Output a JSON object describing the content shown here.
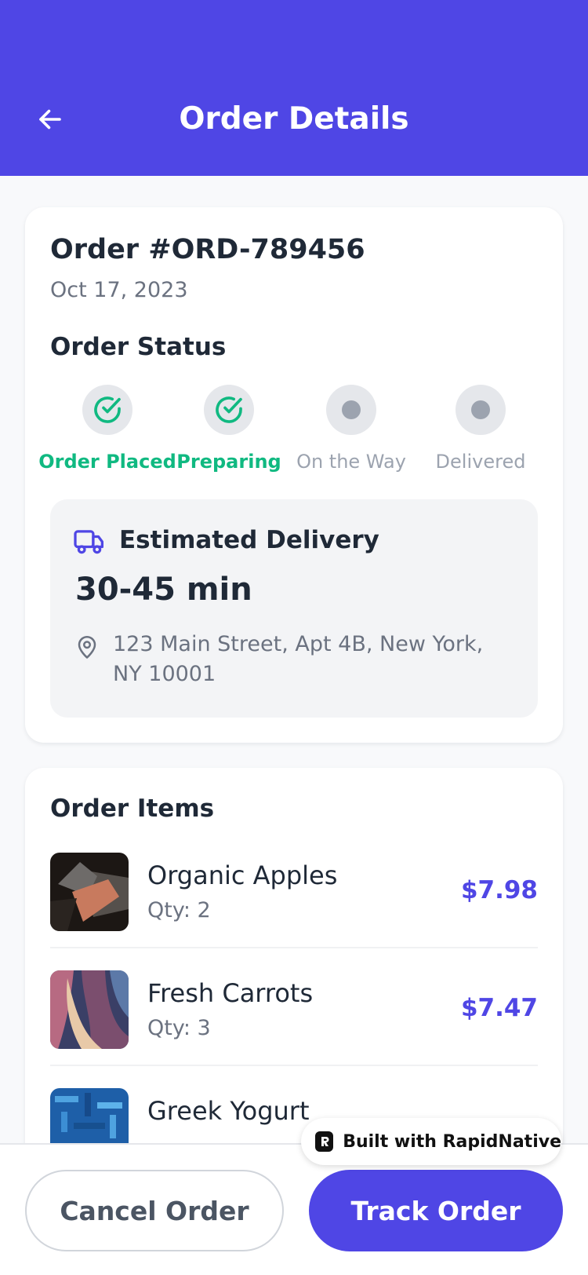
{
  "header": {
    "title": "Order Details",
    "background": "#4F46E5",
    "back_icon": "arrow-left-icon"
  },
  "order": {
    "number": "Order #ORD-789456",
    "date": "Oct 17, 2023",
    "status_heading": "Order Status",
    "steps": [
      {
        "label": "Order Placed",
        "state": "done",
        "icon": "check-circle-icon"
      },
      {
        "label": "Preparing",
        "state": "done",
        "icon": "check-circle-icon"
      },
      {
        "label": "On the Way",
        "state": "pending",
        "icon": "dot-icon"
      },
      {
        "label": "Delivered",
        "state": "pending",
        "icon": "dot-icon"
      }
    ],
    "status_colors": {
      "done": "#10B981",
      "pending": "#9CA3AF"
    }
  },
  "delivery": {
    "label": "Estimated Delivery",
    "eta": "30-45 min",
    "address": "123 Main Street, Apt 4B, New York, NY 10001",
    "truck_icon": "truck-icon",
    "pin_icon": "map-pin-icon"
  },
  "items": {
    "heading": "Order Items",
    "list": [
      {
        "name": "Organic Apples",
        "qty": "Qty: 2",
        "price": "$7.98"
      },
      {
        "name": "Fresh Carrots",
        "qty": "Qty: 3",
        "price": "$7.47"
      },
      {
        "name": "Greek Yogurt",
        "qty": "",
        "price": ""
      }
    ]
  },
  "actions": {
    "cancel_label": "Cancel Order",
    "track_label": "Track Order",
    "accent": "#4F46E5"
  },
  "badge": {
    "text": "Built with RapidNative"
  }
}
